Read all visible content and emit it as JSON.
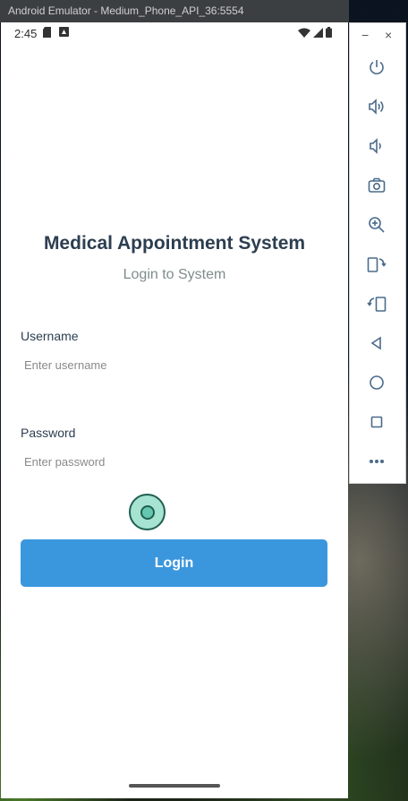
{
  "window": {
    "title": "Android Emulator - Medium_Phone_API_36:5554"
  },
  "status_bar": {
    "time": "2:45",
    "left_icons": [
      "sd-card-icon",
      "notification-icon"
    ],
    "right_icons": [
      "wifi-icon",
      "signal-icon",
      "battery-icon"
    ]
  },
  "app": {
    "title": "Medical Appointment System",
    "subtitle": "Login to System",
    "username": {
      "label": "Username",
      "placeholder": "Enter username",
      "value": ""
    },
    "password": {
      "label": "Password",
      "placeholder": "Enter password",
      "value": ""
    },
    "login_label": "Login"
  },
  "emulator_toolbar": {
    "window_controls": [
      "minimize-icon",
      "close-icon"
    ],
    "minimize_glyph": "−",
    "close_glyph": "×",
    "buttons": [
      "power-icon",
      "volume-up-icon",
      "volume-down-icon",
      "camera-icon",
      "zoom-icon",
      "rotate-left-icon",
      "rotate-right-icon",
      "back-icon",
      "home-icon",
      "overview-icon",
      "more-icon"
    ]
  },
  "colors": {
    "accent": "#3b97dd",
    "title_text": "#2c3e50",
    "subtitle_text": "#7f8c8d",
    "touch_indicator": "#a6e3d1"
  }
}
